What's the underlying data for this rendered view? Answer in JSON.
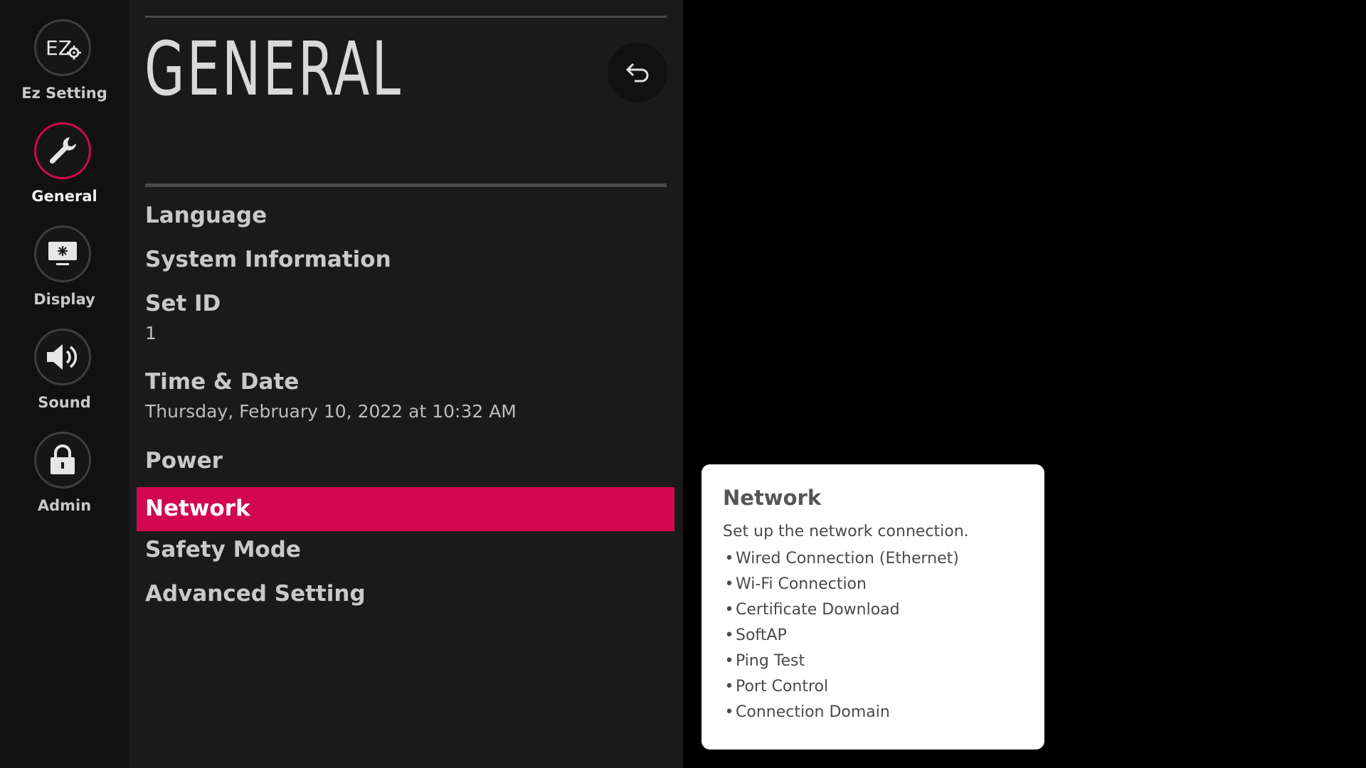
{
  "sidebar": {
    "items": [
      {
        "key": "ez-setting",
        "label": "Ez Setting",
        "icon": "ez-setting-icon",
        "selected": false
      },
      {
        "key": "general",
        "label": "General",
        "icon": "wrench-icon",
        "selected": true
      },
      {
        "key": "display",
        "label": "Display",
        "icon": "display-icon",
        "selected": false
      },
      {
        "key": "sound",
        "label": "Sound",
        "icon": "speaker-icon",
        "selected": false
      },
      {
        "key": "admin",
        "label": "Admin",
        "icon": "lock-icon",
        "selected": false
      }
    ],
    "ez_icon_text": "EZ"
  },
  "main": {
    "title": "GENERAL",
    "back_icon": "back-arrow-icon",
    "menu": [
      {
        "label": "Language"
      },
      {
        "label": "System Information"
      },
      {
        "label": "Set ID",
        "value": "1"
      },
      {
        "label": "Time & Date",
        "value": "Thursday, February 10, 2022 at 10:32 AM"
      },
      {
        "label": "Power"
      },
      {
        "label": "Network",
        "selected": true
      },
      {
        "label": "Safety Mode"
      },
      {
        "label": "Advanced Setting"
      }
    ]
  },
  "help": {
    "title": "Network",
    "description": "Set up the network connection.",
    "bullet_char": "•",
    "bullets": [
      "Wired Connection (Ethernet)",
      "Wi-Fi Connection",
      "Certificate Download",
      "SoftAP",
      "Ping Test",
      "Port Control",
      "Connection Domain"
    ]
  },
  "colors": {
    "accent": "#d2074f",
    "rail_bg": "#111111",
    "panel_bg": "#1a1a1a",
    "text_light": "#c9c9c9",
    "card_bg": "#ffffff"
  }
}
